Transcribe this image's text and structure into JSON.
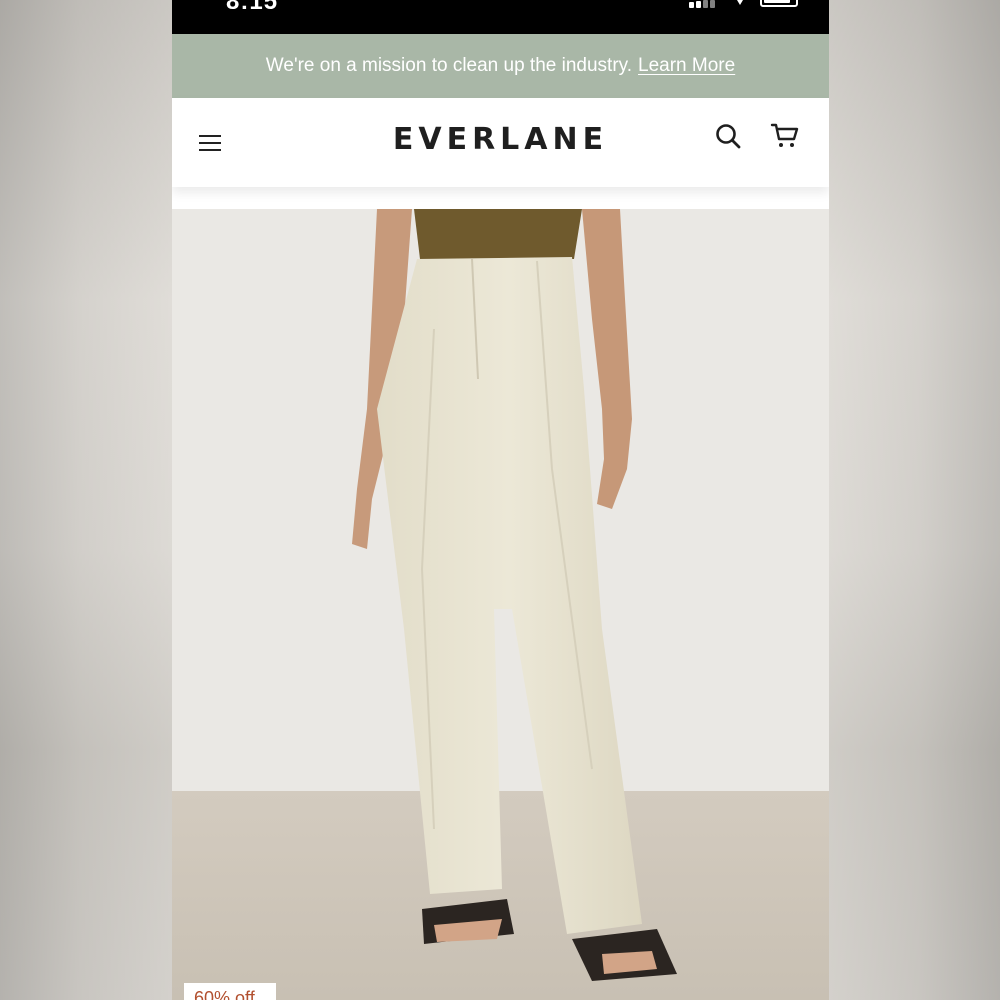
{
  "status_bar": {
    "time": "8:15"
  },
  "promo_banner": {
    "message": "We're on a mission to clean up the industry.",
    "link_label": "Learn More",
    "background": "#a9b7a7"
  },
  "header": {
    "brand": "EVERLANE",
    "menu_icon": "hamburger-menu-icon",
    "search_icon": "search-icon",
    "cart_icon": "cart-icon"
  },
  "product": {
    "discount_badge": "60% off",
    "discount_color": "#b2502f"
  },
  "colors": {
    "status_bar": "#000000",
    "header_text": "#1f1f1f"
  }
}
